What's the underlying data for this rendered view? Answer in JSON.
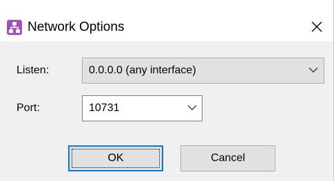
{
  "window": {
    "title": "Network Options",
    "icon": "network-app-icon",
    "close_icon": "close-icon"
  },
  "form": {
    "listen": {
      "label": "Listen:",
      "value": "0.0.0.0 (any interface)"
    },
    "port": {
      "label": "Port:",
      "value": "10731"
    }
  },
  "buttons": {
    "ok_label": "OK",
    "cancel_label": "Cancel"
  },
  "colors": {
    "accent": "#0078d7",
    "app_icon": "#a04fc4",
    "dialog_bg": "#f0f0f0",
    "control_bg": "#e1e1e1"
  }
}
